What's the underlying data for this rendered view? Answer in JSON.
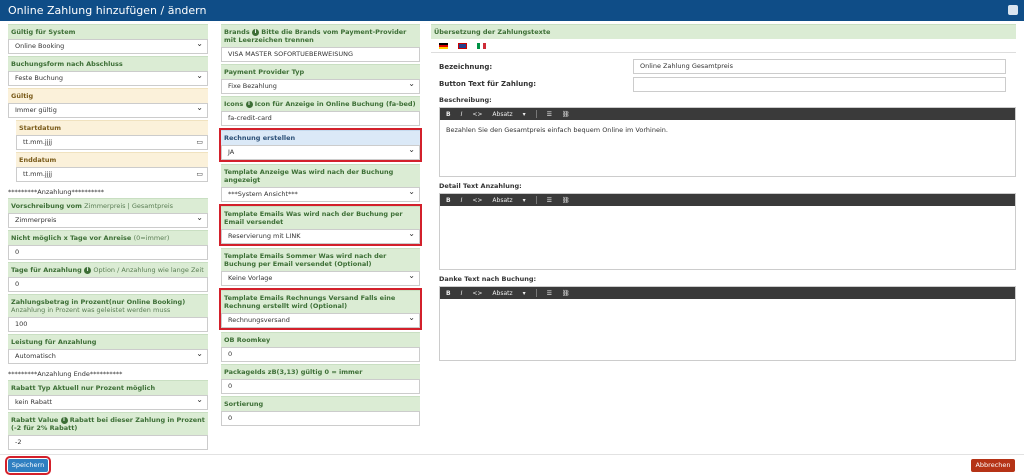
{
  "window": {
    "title": "Online Zahlung hinzufügen / ändern"
  },
  "col1": {
    "gueltig_system_label": "Gültig für System",
    "gueltig_system_value": "Online Booking",
    "buchungsform_label": "Buchungsform nach Abschluss",
    "buchungsform_value": "Feste Buchung",
    "gueltig_label": "Gültig",
    "gueltig_value": "Immer gültig",
    "startdatum_label": "Startdatum",
    "startdatum_value": "tt.mm.jjjj",
    "enddatum_label": "Enddatum",
    "enddatum_value": "tt.mm.jjjj",
    "anzahlung_start": "*********Anzahlung**********",
    "vorschreibung_label_bold": "Vorschreibung vom",
    "vorschreibung_label_norm": "Zimmerpreis | Gesamtpreis",
    "vorschreibung_value": "Zimmerpreis",
    "nicht_moeglich_label_bold": "Nicht möglich x Tage vor Anreise",
    "nicht_moeglich_label_norm": "(0=immer)",
    "nicht_moeglich_value": "0",
    "tage_label_bold": "Tage für Anzahlung",
    "tage_label_norm": "Option / Anzahlung wie lange Zeit",
    "tage_value": "0",
    "zahlungsbetrag_label_bold": "Zahlungsbetrag in Prozent(nur Online Booking)",
    "zahlungsbetrag_label_norm": "Anzahlung in Prozent was geleistet werden muss",
    "zahlungsbetrag_value": "100",
    "leistung_label": "Leistung für Anzahlung",
    "leistung_value": "Automatisch",
    "anzahlung_ende": "*********Anzahlung Ende**********",
    "rabatt_typ_label": "Rabatt Typ Aktuell nur Prozent möglich",
    "rabatt_typ_value": "kein Rabatt",
    "rabatt_value_label_bold": "Rabatt Value",
    "rabatt_value_label_norm": "Rabatt bei dieser Zahlung in Prozent (-2 für 2% Rabatt)",
    "rabatt_value_value": "-2"
  },
  "col2": {
    "brands_label_bold": "Brands",
    "brands_label_norm": "Bitte die Brands vom Payment-Provider mit Leerzeichen trennen",
    "brands_value": "VISA MASTER SOFORTUEBERWEISUNG",
    "provider_typ_label": "Payment Provider Typ",
    "provider_typ_value": "Fixe Bezahlung",
    "icons_label_bold": "Icons",
    "icons_label_norm": "Icon für Anzeige in Online Buchung (fa-bed)",
    "icons_value": "fa-credit-card",
    "rechnung_label": "Rechnung erstellen",
    "rechnung_value": "JA",
    "template_anzeige_label": "Template Anzeige Was wird nach der Buchung angezeigt",
    "template_anzeige_value": "***System Ansicht***",
    "template_emails_label": "Template Emails Was wird nach der Buchung per Email versendet",
    "template_emails_value": "Reservierung mit LINK",
    "template_sommer_label": "Template Emails Sommer Was wird nach der Buchung per Email versendet (Optional)",
    "template_sommer_value": "Keine Vorlage",
    "template_rechnung_label": "Template Emails Rechnungs Versand Falls eine Rechnung erstellt wird (Optional)",
    "template_rechnung_value": "Rechnungsversand",
    "ob_roomkey_label": "OB Roomkey",
    "ob_roomkey_value": "0",
    "packageids_label": "PackageIds zB(3,13) gültig 0 = immer",
    "packageids_value": "0",
    "sortierung_label": "Sortierung",
    "sortierung_value": "0"
  },
  "col3": {
    "uebersetzung_label": "Übersetzung der Zahlungstexte",
    "bezeichnung_label": "Bezeichnung:",
    "bezeichnung_value": "Online Zahlung Gesamtpreis",
    "button_text_label": "Button Text für Zahlung:",
    "beschreibung_label": "Beschreibung:",
    "beschreibung_text": "Bezahlen Sie den Gesamtpreis einfach bequem Online im Vorhinein.",
    "detail_label": "Detail Text Anzahlung:",
    "danke_label": "Danke Text nach Buchung:",
    "toolbar_format": "Absatz"
  },
  "buttons": {
    "save": "Speichern",
    "cancel": "Abbrechen"
  },
  "colors": {
    "title_bar": "#0f4d87",
    "label_bg": "#dbecd4",
    "highlight": "#d3202b",
    "save": "#2f7fc1",
    "cancel": "#b53316"
  }
}
